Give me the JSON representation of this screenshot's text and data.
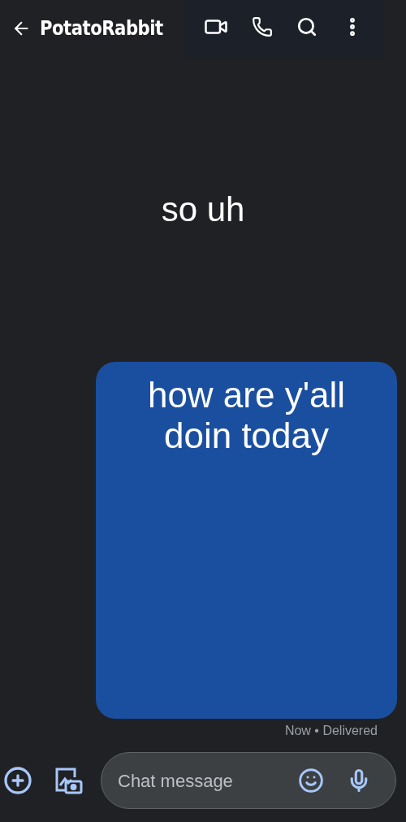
{
  "header": {
    "contact_name": "PotatoRabbit"
  },
  "messages": [
    {
      "kind": "incoming",
      "text": "so uh"
    },
    {
      "kind": "outgoing",
      "text": "how are y'all doin today",
      "status": "Now • Delivered"
    }
  ],
  "composer": {
    "placeholder": "Chat message"
  }
}
